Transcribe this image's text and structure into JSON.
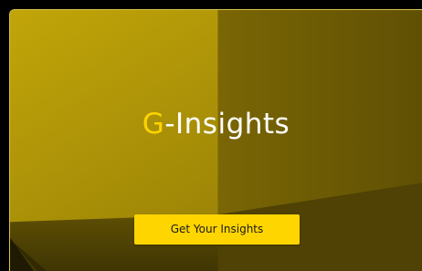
{
  "hero": {
    "title_accent": "G",
    "title_rest": "-Insights",
    "cta_label": "Get Your Insights"
  },
  "colors": {
    "accent": "#ffd400",
    "button": "#ffd500",
    "background_dark": "#000000"
  }
}
